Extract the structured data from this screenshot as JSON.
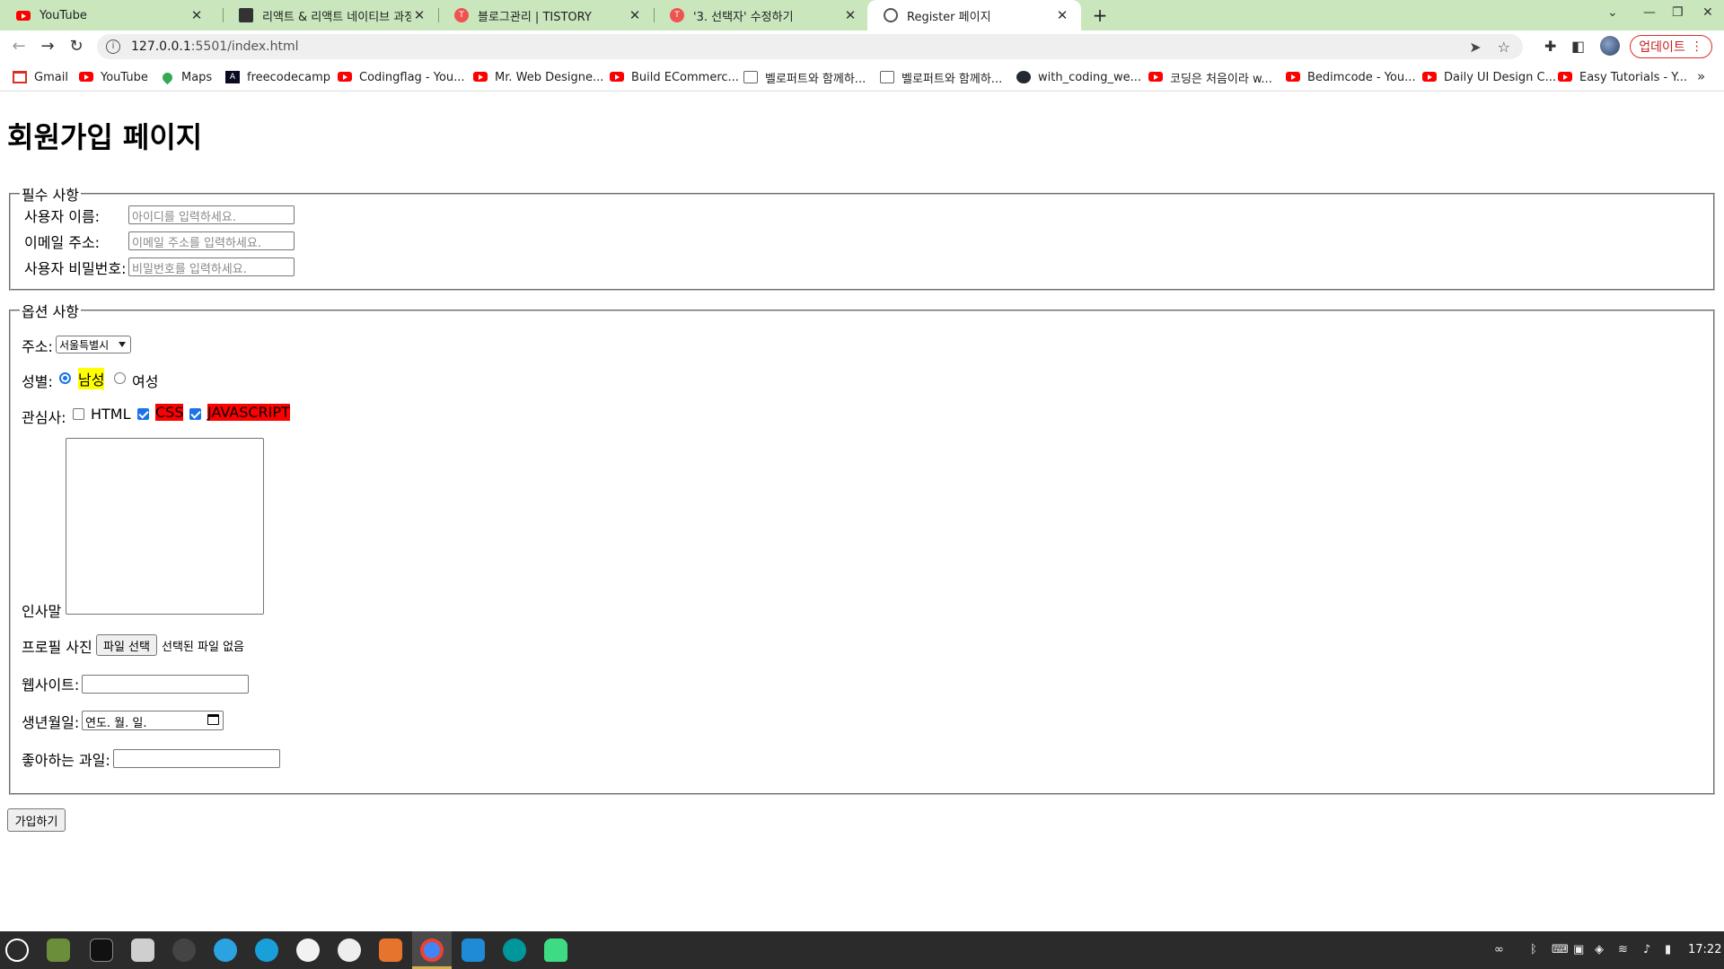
{
  "browser": {
    "tabs": [
      {
        "title": "YouTube",
        "icon": "youtube-icon",
        "active": false
      },
      {
        "title": "리액트 & 리액트 네이티브 과정 ",
        "icon": "document-icon",
        "active": false
      },
      {
        "title": "블로그관리 | TISTORY",
        "icon": "tistory-icon",
        "active": false
      },
      {
        "title": "'3. 선택자' 수정하기",
        "icon": "tistory-icon",
        "active": false
      },
      {
        "title": "Register 페이지",
        "icon": "globe-icon",
        "active": true
      }
    ],
    "url_host": "127.0.0.1",
    "url_path": ":5501/index.html",
    "update_label": "업데이트",
    "bookmarks": [
      {
        "label": "Gmail",
        "icon": "gmail-icon"
      },
      {
        "label": "YouTube",
        "icon": "youtube-icon"
      },
      {
        "label": "Maps",
        "icon": "maps-icon"
      },
      {
        "label": "freecodecamp",
        "icon": "freecodecamp-icon"
      },
      {
        "label": "Codingflag - You...",
        "icon": "youtube-icon"
      },
      {
        "label": "Mr. Web Designe...",
        "icon": "youtube-icon"
      },
      {
        "label": "Build ECommerc...",
        "icon": "youtube-icon"
      },
      {
        "label": "벨로퍼트와 함께하...",
        "icon": "book-icon"
      },
      {
        "label": "벨로퍼트와 함께하...",
        "icon": "book-icon"
      },
      {
        "label": "with_coding_we...",
        "icon": "github-icon"
      },
      {
        "label": "코딩은 처음이라 w...",
        "icon": "youtube-icon"
      },
      {
        "label": "Bedimcode - You...",
        "icon": "youtube-icon"
      },
      {
        "label": "Daily UI Design C...",
        "icon": "youtube-icon"
      },
      {
        "label": "Easy Tutorials - Y...",
        "icon": "youtube-icon"
      }
    ]
  },
  "page": {
    "heading": "회원가입 페이지",
    "required": {
      "legend": "필수 사항",
      "username_label": "사용자 이름:",
      "username_placeholder": "아이디를 입력하세요.",
      "email_label": "이메일 주소:",
      "email_placeholder": "이메일 주소를 입력하세요.",
      "password_label": "사용자 비밀번호:",
      "password_placeholder": "비밀번호를 입력하세요."
    },
    "optional": {
      "legend": "옵션 사항",
      "address_label": "주소:",
      "address_selected": "서울특별시",
      "gender_label": "성별:",
      "gender_male": "남성",
      "gender_female": "여성",
      "gender_selected": "남성",
      "interest_label": "관심사:",
      "interests": [
        {
          "label": "HTML",
          "checked": false
        },
        {
          "label": "CSS",
          "checked": true
        },
        {
          "label": "JAVASCRIPT",
          "checked": true
        }
      ],
      "greeting_label": "인사말",
      "profile_label": "프로필 사진",
      "file_button": "파일 선택",
      "file_status": "선택된 파일 없음",
      "website_label": "웹사이트:",
      "birthday_label": "생년월일:",
      "birthday_placeholder": "연도. 월. 일.",
      "fruit_label": "좋아하는 과일:"
    },
    "submit_label": "가입하기"
  },
  "taskbar": {
    "clock": "17:22"
  },
  "colors": {
    "tabstrip": "#c9e6bd",
    "highlight_yellow": "#ffff00",
    "highlight_red": "#ff0000",
    "accent": "#1a73e8"
  }
}
